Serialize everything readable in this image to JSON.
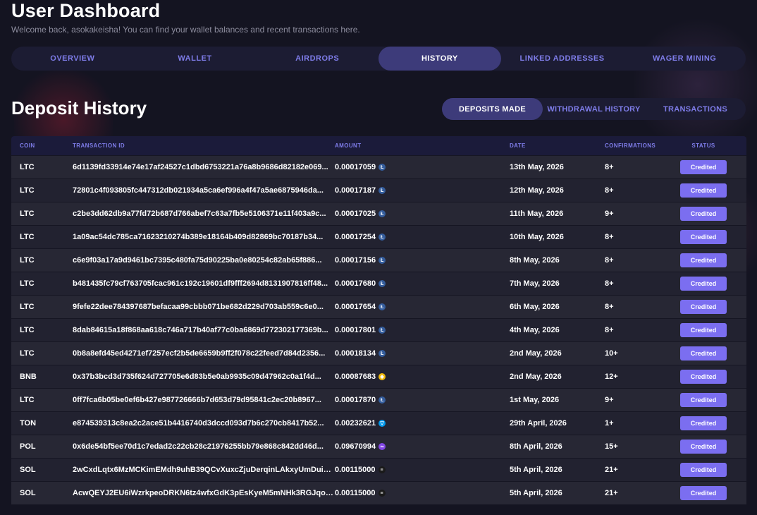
{
  "header": {
    "title": "User Dashboard",
    "subtitle": "Welcome back, asokakeisha! You can find your wallet balances and recent transactions here."
  },
  "main_tabs": [
    {
      "label": "OVERVIEW"
    },
    {
      "label": "WALLET"
    },
    {
      "label": "AIRDROPS"
    },
    {
      "label": "HISTORY",
      "active": true
    },
    {
      "label": "LINKED ADDRESSES"
    },
    {
      "label": "WAGER MINING"
    }
  ],
  "section": {
    "title": "Deposit History"
  },
  "sub_tabs": [
    {
      "label": "DEPOSITS MADE",
      "active": true
    },
    {
      "label": "WITHDRAWAL HISTORY"
    },
    {
      "label": "TRANSACTIONS"
    }
  ],
  "table": {
    "columns": [
      "COIN",
      "TRANSACTION ID",
      "AMOUNT",
      "DATE",
      "CONFIRMATIONS",
      "STATUS"
    ],
    "rows": [
      {
        "coin": "LTC",
        "tx": "6d1139fd33914e74e17af24527c1dbd6753221a76a8b9686d82182e069...",
        "amount": "0.00017059",
        "date": "13th May, 2026",
        "confirmations": "8+",
        "status": "Credited"
      },
      {
        "coin": "LTC",
        "tx": "72801c4f093805fc447312db021934a5ca6ef996a4f47a5ae6875946da...",
        "amount": "0.00017187",
        "date": "12th May, 2026",
        "confirmations": "8+",
        "status": "Credited"
      },
      {
        "coin": "LTC",
        "tx": "c2be3dd62db9a77fd72b687d766abef7c63a7fb5e5106371e11f403a9c...",
        "amount": "0.00017025",
        "date": "11th May, 2026",
        "confirmations": "9+",
        "status": "Credited"
      },
      {
        "coin": "LTC",
        "tx": "1a09ac54dc785ca71623210274b389e18164b409d82869bc70187b34...",
        "amount": "0.00017254",
        "date": "10th May, 2026",
        "confirmations": "8+",
        "status": "Credited"
      },
      {
        "coin": "LTC",
        "tx": "c6e9f03a17a9d9461bc7395c480fa75d90225ba0e80254c82ab65f886...",
        "amount": "0.00017156",
        "date": "8th May, 2026",
        "confirmations": "8+",
        "status": "Credited"
      },
      {
        "coin": "LTC",
        "tx": "b481435fc79cf763705fcac961c192c19601df9fff2694d8131907816ff48...",
        "amount": "0.00017680",
        "date": "7th May, 2026",
        "confirmations": "8+",
        "status": "Credited"
      },
      {
        "coin": "LTC",
        "tx": "9fefe22dee784397687befacaa99cbbb071be682d229d703ab559c6e0...",
        "amount": "0.00017654",
        "date": "6th May, 2026",
        "confirmations": "8+",
        "status": "Credited"
      },
      {
        "coin": "LTC",
        "tx": "8dab84615a18f868aa618c746a717b40af77c0ba6869d772302177369b...",
        "amount": "0.00017801",
        "date": "4th May, 2026",
        "confirmations": "8+",
        "status": "Credited"
      },
      {
        "coin": "LTC",
        "tx": "0b8a8efd45ed4271ef7257ecf2b5de6659b9ff2f078c22feed7d84d2356...",
        "amount": "0.00018134",
        "date": "2nd May, 2026",
        "confirmations": "10+",
        "status": "Credited"
      },
      {
        "coin": "BNB",
        "tx": "0x37b3bcd3d735f624d727705e6d83b5e0ab9935c09d47962c0a1f4d...",
        "amount": "0.00087683",
        "date": "2nd May, 2026",
        "confirmations": "12+",
        "status": "Credited"
      },
      {
        "coin": "LTC",
        "tx": "0ff7fca6b05be0ef6b427e987726666b7d653d79d95841c2ec20b8967...",
        "amount": "0.00017870",
        "date": "1st May, 2026",
        "confirmations": "9+",
        "status": "Credited"
      },
      {
        "coin": "TON",
        "tx": "e874539313c8ea2c2ace51b4416740d3dccd093d7b6c270cb8417b52...",
        "amount": "0.00232621",
        "date": "29th April, 2026",
        "confirmations": "1+",
        "status": "Credited"
      },
      {
        "coin": "POL",
        "tx": "0x6de54bf5ee70d1c7edad2c22cb28c21976255bb79e868c842dd46d...",
        "amount": "0.09670994",
        "date": "8th April, 2026",
        "confirmations": "15+",
        "status": "Credited"
      },
      {
        "coin": "SOL",
        "tx": "2wCxdLqtx6MzMCKimEMdh9uhB39QCvXuxcZjuDerqinLAkxyUmDuiYU...",
        "amount": "0.00115000",
        "date": "5th April, 2026",
        "confirmations": "21+",
        "status": "Credited"
      },
      {
        "coin": "SOL",
        "tx": "AcwQEYJ2EU6iWzrkpeoDRKN6tz4wfxGdK3pEsKyeM5mNHk3RGJqoLT...",
        "amount": "0.00115000",
        "date": "5th April, 2026",
        "confirmations": "21+",
        "status": "Credited"
      }
    ]
  },
  "coin_icons": {
    "LTC": {
      "name": "litecoin-icon",
      "glyph": "Ł",
      "color": "#345d9d"
    },
    "BNB": {
      "name": "bnb-icon",
      "glyph": "◆",
      "color": "#f0b90b"
    },
    "TON": {
      "name": "ton-icon",
      "glyph": "▽",
      "color": "#0098ea"
    },
    "POL": {
      "name": "polygon-icon",
      "glyph": "∞",
      "color": "#8247e5"
    },
    "SOL": {
      "name": "solana-icon",
      "glyph": "≡",
      "color": "#1a1a1a"
    }
  },
  "colors": {
    "accent": "#7e7ce8",
    "active_tab": "#3d3b7a",
    "badge": "#7b6ef0",
    "background": "#141421"
  }
}
